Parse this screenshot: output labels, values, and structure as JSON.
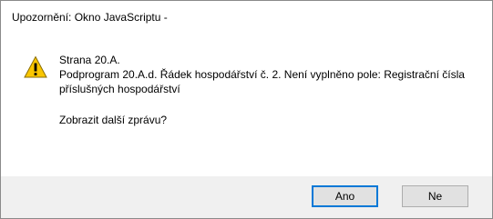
{
  "window": {
    "title": "Upozornění: Okno JavaScriptu -"
  },
  "message": {
    "icon": "warning-icon",
    "line1": "Strana 20.A.",
    "line2": "Podprogram 20.A.d. Řádek hospodářství č. 2. Není vyplněno pole: Registrační čísla příslušných hospodářství",
    "question": "Zobrazit další zprávu?"
  },
  "buttons": {
    "yes_label": "Ano",
    "no_label": "Ne"
  },
  "colors": {
    "focus_border": "#0078d7",
    "footer_bg": "#f0f0f0",
    "warning_fill": "#f9c600"
  }
}
